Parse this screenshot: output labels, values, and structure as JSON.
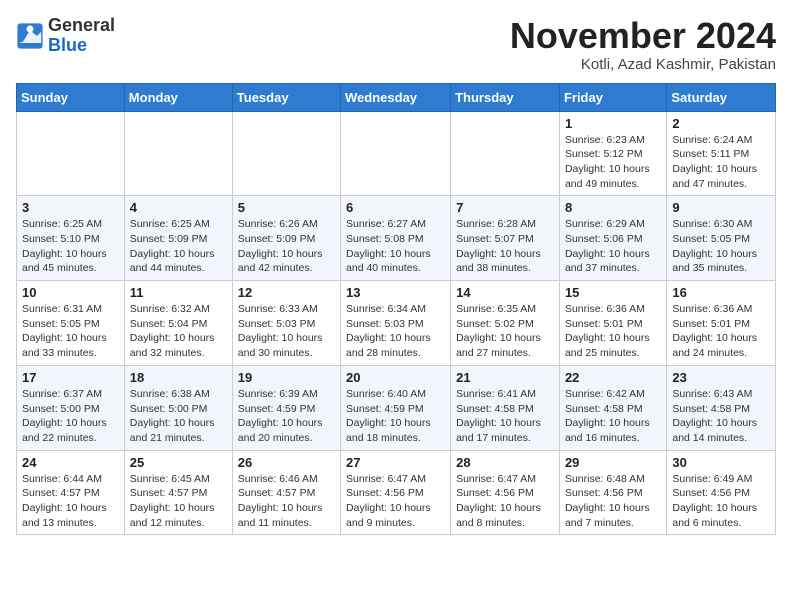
{
  "logo": {
    "general": "General",
    "blue": "Blue"
  },
  "title": "November 2024",
  "location": "Kotli, Azad Kashmir, Pakistan",
  "weekdays": [
    "Sunday",
    "Monday",
    "Tuesday",
    "Wednesday",
    "Thursday",
    "Friday",
    "Saturday"
  ],
  "weeks": [
    [
      {
        "day": "",
        "info": ""
      },
      {
        "day": "",
        "info": ""
      },
      {
        "day": "",
        "info": ""
      },
      {
        "day": "",
        "info": ""
      },
      {
        "day": "",
        "info": ""
      },
      {
        "day": "1",
        "info": "Sunrise: 6:23 AM\nSunset: 5:12 PM\nDaylight: 10 hours\nand 49 minutes."
      },
      {
        "day": "2",
        "info": "Sunrise: 6:24 AM\nSunset: 5:11 PM\nDaylight: 10 hours\nand 47 minutes."
      }
    ],
    [
      {
        "day": "3",
        "info": "Sunrise: 6:25 AM\nSunset: 5:10 PM\nDaylight: 10 hours\nand 45 minutes."
      },
      {
        "day": "4",
        "info": "Sunrise: 6:25 AM\nSunset: 5:09 PM\nDaylight: 10 hours\nand 44 minutes."
      },
      {
        "day": "5",
        "info": "Sunrise: 6:26 AM\nSunset: 5:09 PM\nDaylight: 10 hours\nand 42 minutes."
      },
      {
        "day": "6",
        "info": "Sunrise: 6:27 AM\nSunset: 5:08 PM\nDaylight: 10 hours\nand 40 minutes."
      },
      {
        "day": "7",
        "info": "Sunrise: 6:28 AM\nSunset: 5:07 PM\nDaylight: 10 hours\nand 38 minutes."
      },
      {
        "day": "8",
        "info": "Sunrise: 6:29 AM\nSunset: 5:06 PM\nDaylight: 10 hours\nand 37 minutes."
      },
      {
        "day": "9",
        "info": "Sunrise: 6:30 AM\nSunset: 5:05 PM\nDaylight: 10 hours\nand 35 minutes."
      }
    ],
    [
      {
        "day": "10",
        "info": "Sunrise: 6:31 AM\nSunset: 5:05 PM\nDaylight: 10 hours\nand 33 minutes."
      },
      {
        "day": "11",
        "info": "Sunrise: 6:32 AM\nSunset: 5:04 PM\nDaylight: 10 hours\nand 32 minutes."
      },
      {
        "day": "12",
        "info": "Sunrise: 6:33 AM\nSunset: 5:03 PM\nDaylight: 10 hours\nand 30 minutes."
      },
      {
        "day": "13",
        "info": "Sunrise: 6:34 AM\nSunset: 5:03 PM\nDaylight: 10 hours\nand 28 minutes."
      },
      {
        "day": "14",
        "info": "Sunrise: 6:35 AM\nSunset: 5:02 PM\nDaylight: 10 hours\nand 27 minutes."
      },
      {
        "day": "15",
        "info": "Sunrise: 6:36 AM\nSunset: 5:01 PM\nDaylight: 10 hours\nand 25 minutes."
      },
      {
        "day": "16",
        "info": "Sunrise: 6:36 AM\nSunset: 5:01 PM\nDaylight: 10 hours\nand 24 minutes."
      }
    ],
    [
      {
        "day": "17",
        "info": "Sunrise: 6:37 AM\nSunset: 5:00 PM\nDaylight: 10 hours\nand 22 minutes."
      },
      {
        "day": "18",
        "info": "Sunrise: 6:38 AM\nSunset: 5:00 PM\nDaylight: 10 hours\nand 21 minutes."
      },
      {
        "day": "19",
        "info": "Sunrise: 6:39 AM\nSunset: 4:59 PM\nDaylight: 10 hours\nand 20 minutes."
      },
      {
        "day": "20",
        "info": "Sunrise: 6:40 AM\nSunset: 4:59 PM\nDaylight: 10 hours\nand 18 minutes."
      },
      {
        "day": "21",
        "info": "Sunrise: 6:41 AM\nSunset: 4:58 PM\nDaylight: 10 hours\nand 17 minutes."
      },
      {
        "day": "22",
        "info": "Sunrise: 6:42 AM\nSunset: 4:58 PM\nDaylight: 10 hours\nand 16 minutes."
      },
      {
        "day": "23",
        "info": "Sunrise: 6:43 AM\nSunset: 4:58 PM\nDaylight: 10 hours\nand 14 minutes."
      }
    ],
    [
      {
        "day": "24",
        "info": "Sunrise: 6:44 AM\nSunset: 4:57 PM\nDaylight: 10 hours\nand 13 minutes."
      },
      {
        "day": "25",
        "info": "Sunrise: 6:45 AM\nSunset: 4:57 PM\nDaylight: 10 hours\nand 12 minutes."
      },
      {
        "day": "26",
        "info": "Sunrise: 6:46 AM\nSunset: 4:57 PM\nDaylight: 10 hours\nand 11 minutes."
      },
      {
        "day": "27",
        "info": "Sunrise: 6:47 AM\nSunset: 4:56 PM\nDaylight: 10 hours\nand 9 minutes."
      },
      {
        "day": "28",
        "info": "Sunrise: 6:47 AM\nSunset: 4:56 PM\nDaylight: 10 hours\nand 8 minutes."
      },
      {
        "day": "29",
        "info": "Sunrise: 6:48 AM\nSunset: 4:56 PM\nDaylight: 10 hours\nand 7 minutes."
      },
      {
        "day": "30",
        "info": "Sunrise: 6:49 AM\nSunset: 4:56 PM\nDaylight: 10 hours\nand 6 minutes."
      }
    ]
  ]
}
